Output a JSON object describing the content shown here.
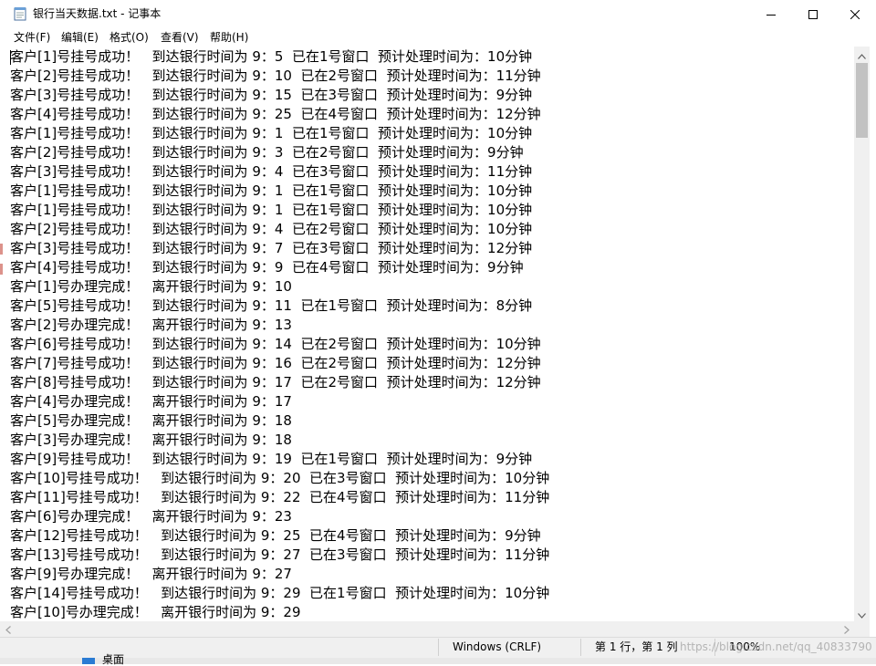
{
  "window": {
    "title": "银行当天数据.txt - 记事本"
  },
  "menu": {
    "file": "文件(F)",
    "edit": "编辑(E)",
    "format": "格式(O)",
    "view": "查看(V)",
    "help": "帮助(H)"
  },
  "content": {
    "lines": [
      "客户[1]号挂号成功！   到达银行时间为 9：5  已在1号窗口  预计处理时间为：10分钟",
      "客户[2]号挂号成功！   到达银行时间为 9：10  已在2号窗口  预计处理时间为：11分钟",
      "客户[3]号挂号成功！   到达银行时间为 9：15  已在3号窗口  预计处理时间为：9分钟",
      "客户[4]号挂号成功！   到达银行时间为 9：25  已在4号窗口  预计处理时间为：12分钟",
      "客户[1]号挂号成功！   到达银行时间为 9：1  已在1号窗口  预计处理时间为：10分钟",
      "客户[2]号挂号成功！   到达银行时间为 9：3  已在2号窗口  预计处理时间为：9分钟",
      "客户[3]号挂号成功！   到达银行时间为 9：4  已在3号窗口  预计处理时间为：11分钟",
      "客户[1]号挂号成功！   到达银行时间为 9：1  已在1号窗口  预计处理时间为：10分钟",
      "客户[1]号挂号成功！   到达银行时间为 9：1  已在1号窗口  预计处理时间为：10分钟",
      "客户[2]号挂号成功！   到达银行时间为 9：4  已在2号窗口  预计处理时间为：10分钟",
      "客户[3]号挂号成功！   到达银行时间为 9：7  已在3号窗口  预计处理时间为：12分钟",
      "客户[4]号挂号成功！   到达银行时间为 9：9  已在4号窗口  预计处理时间为：9分钟",
      "客户[1]号办理完成！   离开银行时间为 9：10",
      "客户[5]号挂号成功！   到达银行时间为 9：11  已在1号窗口  预计处理时间为：8分钟",
      "客户[2]号办理完成！   离开银行时间为 9：13",
      "客户[6]号挂号成功！   到达银行时间为 9：14  已在2号窗口  预计处理时间为：10分钟",
      "客户[7]号挂号成功！   到达银行时间为 9：16  已在2号窗口  预计处理时间为：12分钟",
      "客户[8]号挂号成功！   到达银行时间为 9：17  已在2号窗口  预计处理时间为：12分钟",
      "客户[4]号办理完成！   离开银行时间为 9：17",
      "客户[5]号办理完成！   离开银行时间为 9：18",
      "客户[3]号办理完成！   离开银行时间为 9：18",
      "客户[9]号挂号成功！   到达银行时间为 9：19  已在1号窗口  预计处理时间为：9分钟",
      "客户[10]号挂号成功！   到达银行时间为 9：20  已在3号窗口  预计处理时间为：10分钟",
      "客户[11]号挂号成功！   到达银行时间为 9：22  已在4号窗口  预计处理时间为：11分钟",
      "客户[6]号办理完成！   离开银行时间为 9：23",
      "客户[12]号挂号成功！   到达银行时间为 9：25  已在4号窗口  预计处理时间为：9分钟",
      "客户[13]号挂号成功！   到达银行时间为 9：27  已在3号窗口  预计处理时间为：11分钟",
      "客户[9]号办理完成！   离开银行时间为 9：27",
      "客户[14]号挂号成功！   到达银行时间为 9：29  已在1号窗口  预计处理时间为：10分钟",
      "客户[10]号办理完成！   离开银行时间为 9：29"
    ]
  },
  "status": {
    "encoding": "Windows (CRLF)",
    "position": "第 1 行，第 1 列",
    "zoom": "100%",
    "watermark": "https://blog.csdn.net/qq_40833790"
  },
  "desktop": {
    "label": "桌面"
  },
  "colors": {
    "title_bg": "#ffffff",
    "status_bg": "#f0f0f0",
    "scrollbar_thumb": "#c2c2c2"
  },
  "icons": {
    "app": "notepad-icon",
    "minimize": "minimize-icon",
    "maximize": "maximize-icon",
    "close": "close-icon"
  }
}
